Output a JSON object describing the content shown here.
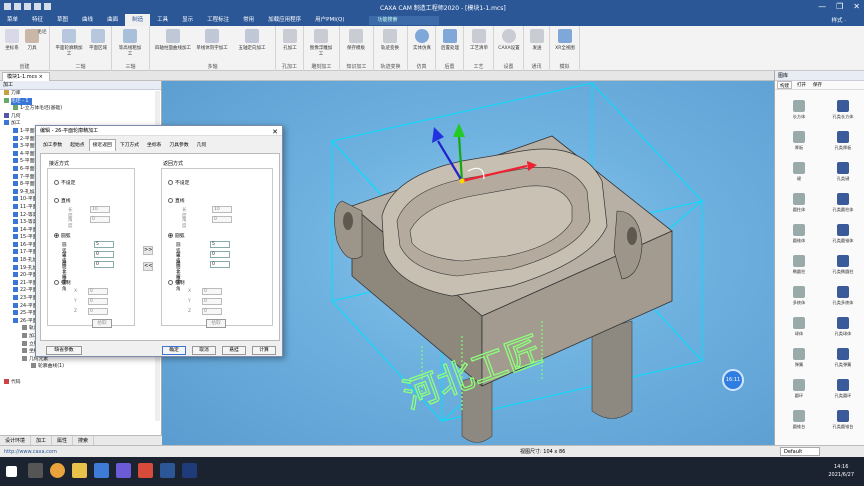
{
  "window": {
    "title": "CAXA CAM 制造工程师2020 - [模块1-1.mcs]",
    "controls": [
      "—",
      "❐",
      "✕"
    ]
  },
  "menu": {
    "items": [
      "菜单",
      "特征",
      "草图",
      "曲线",
      "曲面",
      "制造",
      "工具",
      "显示",
      "工程标注",
      "常用",
      "加载应用程序",
      "用户PMI(Q)"
    ],
    "active_index": 5,
    "search_placeholder": "功能搜索",
    "style_label": "样式 ·"
  },
  "ribbon": {
    "groups": [
      {
        "label": "创建",
        "buttons": [
          "坐标系",
          "刀具",
          "毛坯"
        ]
      },
      {
        "label": "二轴",
        "buttons": [
          "平面轮廓精加工",
          "平面区域"
        ]
      },
      {
        "label": "三轴",
        "buttons": [
          "等高线粗加工"
        ]
      },
      {
        "label": "多轴",
        "buttons": [
          "四轴柱面曲线加工",
          "单线体刻字加工",
          "五轴定向加工"
        ]
      },
      {
        "label": "孔加工",
        "buttons": [
          "孔加工"
        ]
      },
      {
        "label": "雕刻加工",
        "buttons": [
          "图像浮雕加工"
        ]
      },
      {
        "label": "知识加工",
        "buttons": [
          "保存模板"
        ]
      },
      {
        "label": "轨迹变换",
        "buttons": [
          "轨迹变换"
        ]
      },
      {
        "label": "仿真",
        "buttons": [
          "实体仿真"
        ]
      },
      {
        "label": "后置",
        "buttons": [
          "后置处理"
        ]
      },
      {
        "label": "工艺",
        "buttons": [
          "工艺清单"
        ]
      },
      {
        "label": "设置",
        "buttons": [
          "CAXA设置"
        ]
      },
      {
        "label": "通讯",
        "buttons": [
          "发送"
        ]
      },
      {
        "label": "模拟",
        "buttons": [
          "XR全视图"
        ]
      }
    ]
  },
  "doc_tab": "模块1-1.mcs ×",
  "tree": {
    "header": "加工",
    "rows": [
      {
        "text": "刀库",
        "indent": 0,
        "icon": "#c8a040"
      },
      {
        "text": "毛坯 - 1",
        "indent": 0,
        "icon": "#6a6",
        "selected": true
      },
      {
        "text": "1-立方体毛坯(基础)",
        "indent": 1,
        "icon": "#6a6"
      },
      {
        "text": "几何",
        "indent": 0,
        "icon": "#55a"
      },
      {
        "text": "加工",
        "indent": 0,
        "icon": "#3a76d8"
      },
      {
        "text": "1-平面轮廓精加工",
        "indent": 1,
        "icon": "#3a76d8"
      },
      {
        "text": "2-平面轮廓精加工",
        "indent": 1,
        "icon": "#3a76d8"
      },
      {
        "text": "3-平面区域粗加工",
        "indent": 1,
        "icon": "#3a76d8"
      },
      {
        "text": "4-平面轮廓精加工",
        "indent": 1,
        "icon": "#3a76d8"
      },
      {
        "text": "5-平面区域粗加工",
        "indent": 1,
        "icon": "#3a76d8"
      },
      {
        "text": "6-平面轮廓精加工",
        "indent": 1,
        "icon": "#3a76d8"
      },
      {
        "text": "7-平面轮廓精加工",
        "indent": 1,
        "icon": "#3a76d8"
      },
      {
        "text": "8-平面区域粗加工",
        "indent": 1,
        "icon": "#3a76d8"
      },
      {
        "text": "9-孔加工",
        "indent": 1,
        "icon": "#3a76d8"
      },
      {
        "text": "10-平面轮廓精加工",
        "indent": 1,
        "icon": "#3a76d8"
      },
      {
        "text": "11-平面轮廓精加工",
        "indent": 1,
        "icon": "#3a76d8"
      },
      {
        "text": "12-等高线粗加工",
        "indent": 1,
        "icon": "#3a76d8"
      },
      {
        "text": "13-等高线精加工",
        "indent": 1,
        "icon": "#3a76d8"
      },
      {
        "text": "14-平面轮廓精加工",
        "indent": 1,
        "icon": "#3a76d8"
      },
      {
        "text": "15-平面轮廓精加工",
        "indent": 1,
        "icon": "#3a76d8"
      },
      {
        "text": "16-平面区域粗加工",
        "indent": 1,
        "icon": "#3a76d8"
      },
      {
        "text": "17-平面轮廓精加工",
        "indent": 1,
        "icon": "#3a76d8"
      },
      {
        "text": "18-孔加工",
        "indent": 1,
        "icon": "#3a76d8"
      },
      {
        "text": "19-孔加工",
        "indent": 1,
        "icon": "#3a76d8"
      },
      {
        "text": "20-平面轮廓精加工",
        "indent": 1,
        "icon": "#3a76d8"
      },
      {
        "text": "21-平面区域粗加工",
        "indent": 1,
        "icon": "#3a76d8"
      },
      {
        "text": "22-平面轮廓精加工",
        "indent": 1,
        "icon": "#3a76d8"
      },
      {
        "text": "23-平面区域粗加工",
        "indent": 1,
        "icon": "#3a76d8"
      },
      {
        "text": "24-平面轮廓精加工",
        "indent": 1,
        "icon": "#3a76d8"
      },
      {
        "text": "25-平面轮廓精加工",
        "indent": 1,
        "icon": "#3a76d8"
      },
      {
        "text": "26-平面轮廓精加工",
        "indent": 1,
        "icon": "#3a76d8"
      },
      {
        "text": "轨迹数据",
        "indent": 2,
        "icon": "#888"
      },
      {
        "text": "加工参数",
        "indent": 2,
        "icon": "#888"
      },
      {
        "text": "立铣刀 D(10,0) ID(0)",
        "indent": 2,
        "icon": "#888"
      },
      {
        "text": "坐标系",
        "indent": 2,
        "icon": "#888"
      },
      {
        "text": "几何元素",
        "indent": 2,
        "icon": "#888"
      },
      {
        "text": "轮廓曲线(1)",
        "indent": 3,
        "icon": "#888"
      },
      {
        "text": "",
        "indent": 0,
        "icon": ""
      },
      {
        "text": "代码",
        "indent": 0,
        "icon": "#c44"
      }
    ],
    "bottom_tabs": [
      "设计环境",
      "加工",
      "属性",
      "搜索"
    ]
  },
  "dialog": {
    "title": "编辑 - 26-平面轮廓精加工",
    "close": "✕",
    "tabs": [
      "加工参数",
      "起始点",
      "接近返回",
      "下刀方式",
      "坐标系",
      "刀具参数",
      "几何"
    ],
    "active_tab": 2,
    "approach": {
      "title": "接近方式",
      "options": [
        "不设定",
        "直线",
        "圆弧",
        "强制"
      ],
      "selected": 2,
      "line": {
        "length_label": "长度",
        "length": "10",
        "angle_label": "角度",
        "angle": "0"
      },
      "arc": {
        "radius_label": "圆弧半径",
        "radius": "5",
        "angle_label": "转弧延长量",
        "angle": "0",
        "ext_label": "延长线转角",
        "ext": "0"
      },
      "force": {
        "x_label": "X",
        "x": "0",
        "y_label": "Y",
        "y": "0",
        "z_label": "Z",
        "z": "0",
        "pick": "拾取"
      }
    },
    "retract": {
      "title": "返回方式",
      "options": [
        "不设定",
        "直线",
        "圆弧",
        "强制"
      ],
      "selected": 2,
      "line": {
        "length_label": "长度",
        "length": "10",
        "angle_label": "角度",
        "angle": "0"
      },
      "arc": {
        "radius_label": "圆弧半径",
        "radius": "5",
        "angle_label": "转弧延长量",
        "angle": "0",
        "ext_label": "延长线转角",
        "ext": "0"
      },
      "force": {
        "x_label": "X",
        "x": "0",
        "y_label": "Y",
        "y": "0",
        "z_label": "Z",
        "z": "0",
        "pick": "拾取"
      }
    },
    "copy_left": ">>",
    "copy_right": "<<",
    "buttons": {
      "defaults": "缺省参数",
      "ok": "确定",
      "cancel": "取消",
      "hide": "悬挂",
      "calc": "计算"
    }
  },
  "viewport": {
    "engraving_text": "河北工匠",
    "badge": "16:11"
  },
  "rightpanel": {
    "title": "图库",
    "tabs": [
      "构建",
      "打开",
      "保存"
    ],
    "items": [
      {
        "label": "长方体",
        "color": "#9aa"
      },
      {
        "label": "孔类长方体",
        "color": "#3a5a9a"
      },
      {
        "label": "厚板",
        "color": "#9aa"
      },
      {
        "label": "孔类厚板",
        "color": "#3a5a9a"
      },
      {
        "label": "键",
        "color": "#9aa"
      },
      {
        "label": "孔类键",
        "color": "#3a5a9a"
      },
      {
        "label": "圆柱体",
        "color": "#9aa"
      },
      {
        "label": "孔类圆柱体",
        "color": "#3a5a9a"
      },
      {
        "label": "圆锥体",
        "color": "#9aa"
      },
      {
        "label": "孔类圆锥体",
        "color": "#3a5a9a"
      },
      {
        "label": "椭圆柱",
        "color": "#9aa"
      },
      {
        "label": "孔类椭圆柱",
        "color": "#3a5a9a"
      },
      {
        "label": "多棱体",
        "color": "#9aa"
      },
      {
        "label": "孔类多棱体",
        "color": "#3a5a9a"
      },
      {
        "label": "球体",
        "color": "#9aa"
      },
      {
        "label": "孔类球体",
        "color": "#3a5a9a"
      },
      {
        "label": "弹簧",
        "color": "#9aa"
      },
      {
        "label": "孔类弹簧",
        "color": "#3a5a9a"
      },
      {
        "label": "圆环",
        "color": "#9aa"
      },
      {
        "label": "孔类圆环",
        "color": "#3a5a9a"
      },
      {
        "label": "圆锥台",
        "color": "#9aa"
      },
      {
        "label": "孔类圆锥台",
        "color": "#3a5a9a"
      }
    ],
    "bottom_tabs": [
      "图库",
      "设计元素",
      "钣金",
      "工具"
    ]
  },
  "statusbar": {
    "left": "http://www.caxa.com",
    "mid": "视图尺寸: 104 x 86",
    "units": "Default"
  },
  "taskbar": {
    "time": "14:16",
    "date": "2021/6/27"
  }
}
